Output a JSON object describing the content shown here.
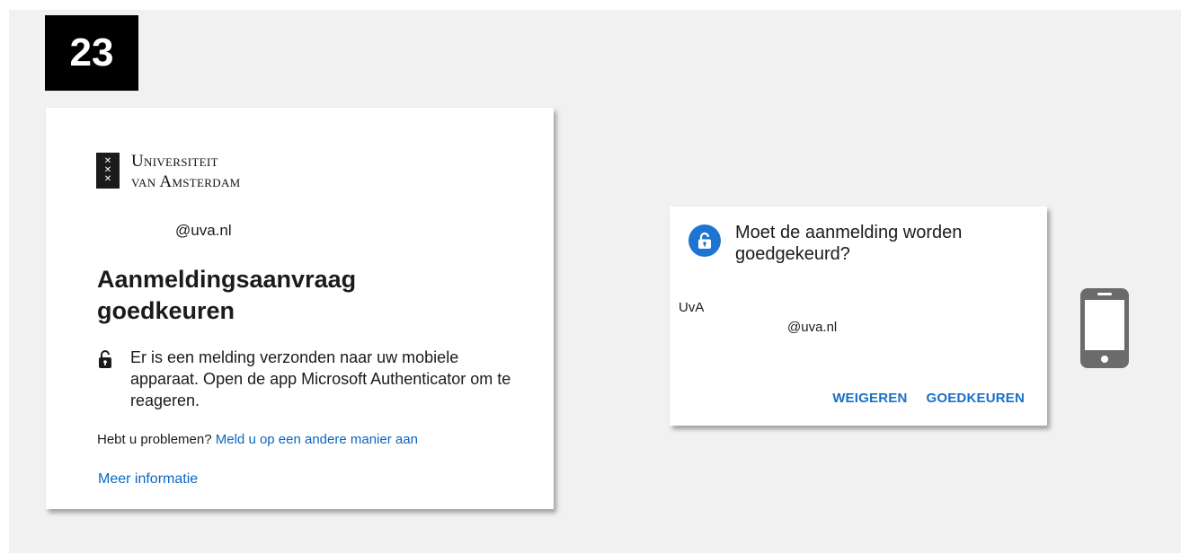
{
  "step": {
    "number": "23"
  },
  "signin": {
    "org_name_line1": "Universiteit",
    "org_name_line2": "van Amsterdam",
    "emblem_glyphs": [
      "✕",
      "✕",
      "✕"
    ],
    "account_email": "@uva.nl",
    "title": "Aanmeldingsaanvraag goedkeuren",
    "notice": "Er is een melding verzonden naar uw mobiele apparaat. Open de app Microsoft Authenticator om te reageren.",
    "problems_prefix": "Hebt u problemen?",
    "problems_link": "Meld u op een andere manier aan",
    "more_info_link": "Meer informatie",
    "notice_icon": "lock-icon"
  },
  "phone_dialog": {
    "title": "Moet de aanmelding worden goedgekeurd?",
    "org": "UvA",
    "account_email": "@uva.nl",
    "deny_label": "WEIGEREN",
    "approve_label": "GOEDKEUREN",
    "icon": "lock-icon",
    "accent_color": "#1a6fc9"
  },
  "device_icon": "smartphone-icon",
  "colors": {
    "link": "#0b66c2",
    "stage_bg": "#f1f1f1",
    "badge_bg": "#000000"
  }
}
